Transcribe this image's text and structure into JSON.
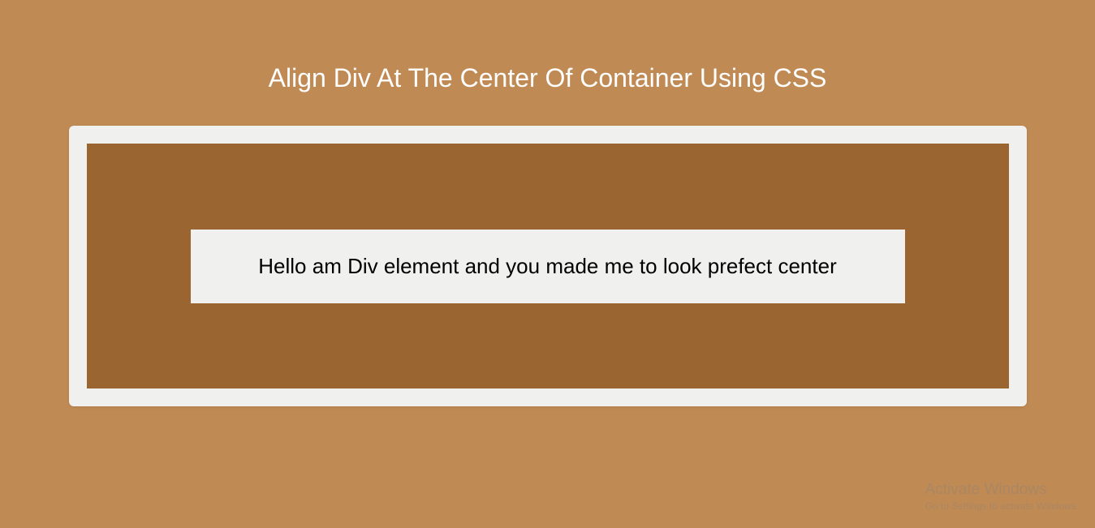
{
  "page": {
    "title": "Align Div At The Center Of Container Using CSS"
  },
  "centerBox": {
    "text": "Hello am Div element and you made me to look prefect center"
  },
  "watermark": {
    "title": "Activate Windows",
    "subtitle": "Go to Settings to activate Windows."
  },
  "colors": {
    "pageBackground": "#c08a54",
    "outerContainer": "#f0f0ee",
    "innerContainer": "#9a6531",
    "centerBox": "#f0f0ee",
    "titleText": "#ffffff",
    "bodyText": "#000000"
  }
}
